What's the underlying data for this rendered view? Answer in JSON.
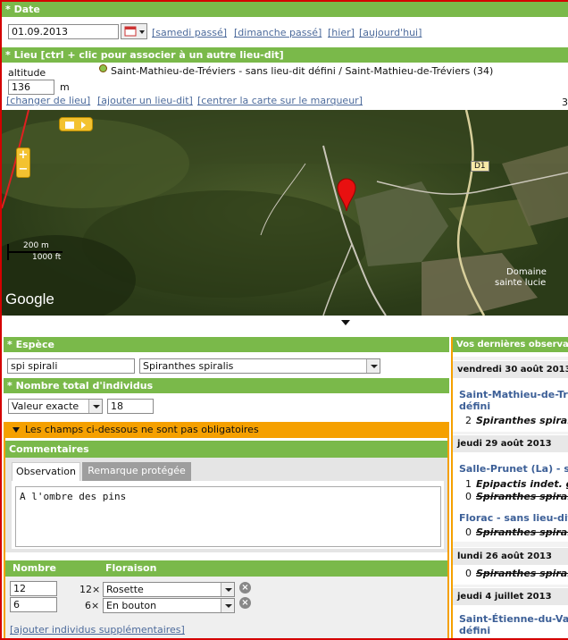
{
  "date": {
    "header": "* Date",
    "value": "01.09.2013",
    "links": [
      "[samedi passé]",
      "[dimanche passé]",
      "[hier]",
      "[aujourd'hui]"
    ]
  },
  "lieu": {
    "header": "* Lieu [ctrl + clic pour associer à un autre lieu-dit]",
    "altitude_label": "altitude",
    "altitude_value": "136",
    "altitude_unit": "m",
    "place": "Saint-Mathieu-de-Tréviers - sans lieu-dit défini / Saint-Mathieu-de-Tréviers (34)",
    "links": [
      "[changer de lieu]",
      "[ajouter un lieu-dit]",
      "[centrer la carte sur le marqueur]"
    ],
    "trailing": "3"
  },
  "map": {
    "road_badge": "D1",
    "scale_m": "200 m",
    "scale_ft": "1000 ft",
    "place_label_1": "Domaine",
    "place_label_2": "sainte lucie",
    "brand": "Google"
  },
  "espece": {
    "header": "* Espèce",
    "search": "spi spirali",
    "selected": "Spiranthes spiralis"
  },
  "nombre": {
    "header": "* Nombre total d'individus",
    "mode": "Valeur exacte",
    "value": "18"
  },
  "optional": {
    "banner": "Les champs ci-dessous ne sont pas obligatoires",
    "comments_header": "Commentaires",
    "tabs": [
      "Observation",
      "Remarque protégée"
    ],
    "comment": "A l'ombre des pins"
  },
  "table": {
    "col_nombre": "Nombre",
    "col_floraison": "Floraison",
    "rows": [
      {
        "n": "12",
        "mult": "12×",
        "stage": "Rosette"
      },
      {
        "n": "6",
        "mult": "6×",
        "stage": "En bouton"
      }
    ],
    "add_link": "[ajouter individus supplémentaires]"
  },
  "sidebar": {
    "header": "Vos dernières observa",
    "days": [
      {
        "date": "vendredi 30 août 2013",
        "place_l1": "Saint-Mathieu-de-Tré",
        "place_l2": "défini",
        "items": [
          {
            "n": "2",
            "name": "Spiranthes spiralis",
            "strike": false
          }
        ]
      },
      {
        "date": "jeudi 29 août 2013",
        "place_l1": "Salle-Prunet (La) - sa",
        "items": [
          {
            "n": "1",
            "name": "Epipactis indet. gr",
            "strike": false
          },
          {
            "n": "0",
            "name": "Spiranthes spiralis",
            "strike": true
          }
        ],
        "place2": "Florac - sans lieu-dit d",
        "items2": [
          {
            "n": "0",
            "name": "Spiranthes spiralis",
            "strike": true
          }
        ]
      },
      {
        "date": "lundi 26 août 2013",
        "items": [
          {
            "n": "0",
            "name": "Spiranthes spiralis",
            "strike": true
          }
        ]
      },
      {
        "date": "jeudi 4 juillet 2013",
        "place_l1": "Saint-Étienne-du-Valo",
        "place_l2": "défini"
      }
    ]
  },
  "colors": {
    "green": "#7ab94a",
    "orange": "#f5a000",
    "link": "#4d6b9c",
    "red": "#d40000"
  }
}
